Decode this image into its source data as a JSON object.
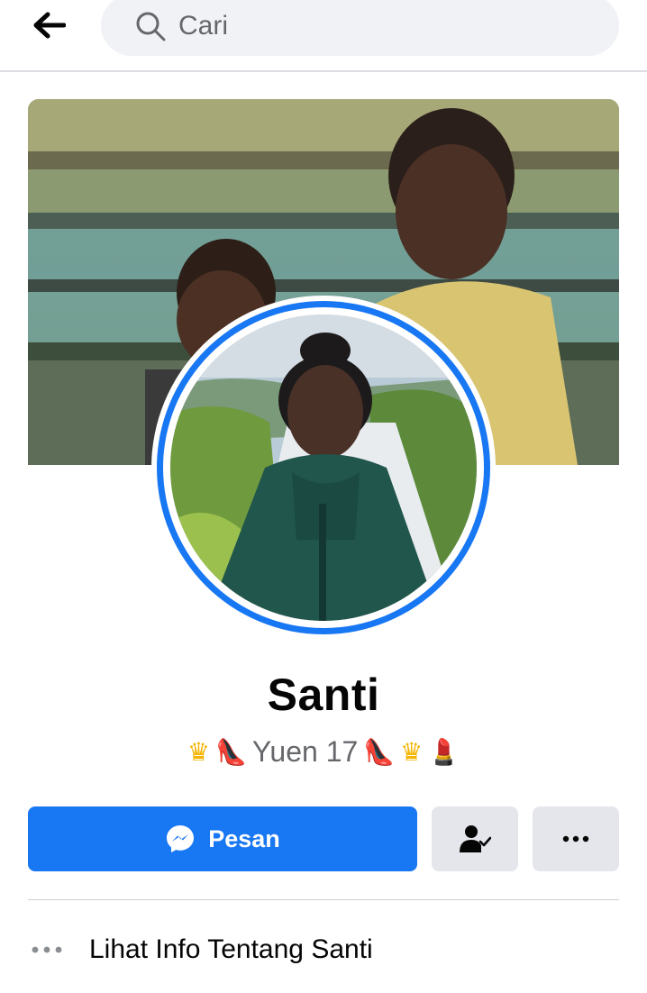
{
  "header": {
    "back_icon": "arrow-left-icon",
    "search_icon": "search-icon",
    "search_placeholder": "Cari"
  },
  "profile": {
    "name": "Santi",
    "bio_text": "Yuen 17",
    "bio_emojis": {
      "before": [
        "crown",
        "high-heel"
      ],
      "after": [
        "high-heel",
        "crown",
        "lipstick"
      ]
    }
  },
  "actions": {
    "message_label": "Pesan",
    "message_icon": "messenger-icon",
    "friends_icon": "friends-check-icon",
    "more_icon": "more-dots-icon"
  },
  "info": {
    "label": "Lihat Info Tentang Santi",
    "icon": "more-dots-icon"
  },
  "colors": {
    "accent": "#1877f2",
    "secondary_button": "#e4e6eb",
    "search_bg": "#f0f2f5",
    "muted_text": "#65676b"
  }
}
